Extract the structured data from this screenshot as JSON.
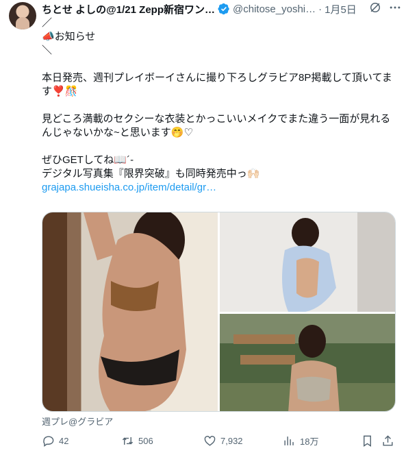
{
  "tweet": {
    "display_name": "ちとせ よしの@1/21 Zepp新宿ワン…",
    "handle": "@chitose_yoshi…",
    "separator": "·",
    "time": "1月5日",
    "body": {
      "line1": "／",
      "line2_emoji": "📣",
      "line2_text": "お知らせ",
      "line3": "＼",
      "line5": "本日発売、週刊プレイボーイさんに撮り下ろしグラビア8P掲載して頂いてま",
      "line6_text": "す",
      "line6_emoji": "❣️🎊",
      "line8": "見どころ満載のセクシーな衣装とかっこいいメイクでまた違う一面が見れる",
      "line9_text": "んじゃないかな~と思います",
      "line9_emoji": "🤭♡",
      "line11_text": "ぜひGETしてね",
      "line11_emoji": "📖",
      "line11_suffix": "´-",
      "line12_text": "デジタル写真集『限界突破』も同時発売中っ",
      "line12_emoji": "🙌🏻",
      "link": "grajapa.shueisha.co.jp/item/detail/gr…"
    },
    "media_caption": "週プレ@グラビア",
    "actions": {
      "replies": "42",
      "retweets": "506",
      "likes": "7,932",
      "views": "18万"
    }
  },
  "icons": {
    "verified": "verified-badge-icon",
    "grok": "grok-icon",
    "more": "more-icon",
    "reply": "reply-icon",
    "retweet": "retweet-icon",
    "like": "like-icon",
    "views": "views-icon",
    "bookmark": "bookmark-icon",
    "share": "share-icon"
  },
  "colors": {
    "text": "#0f1419",
    "secondary": "#536471",
    "link": "#1d9bf0",
    "verified": "#1d9bf0"
  }
}
